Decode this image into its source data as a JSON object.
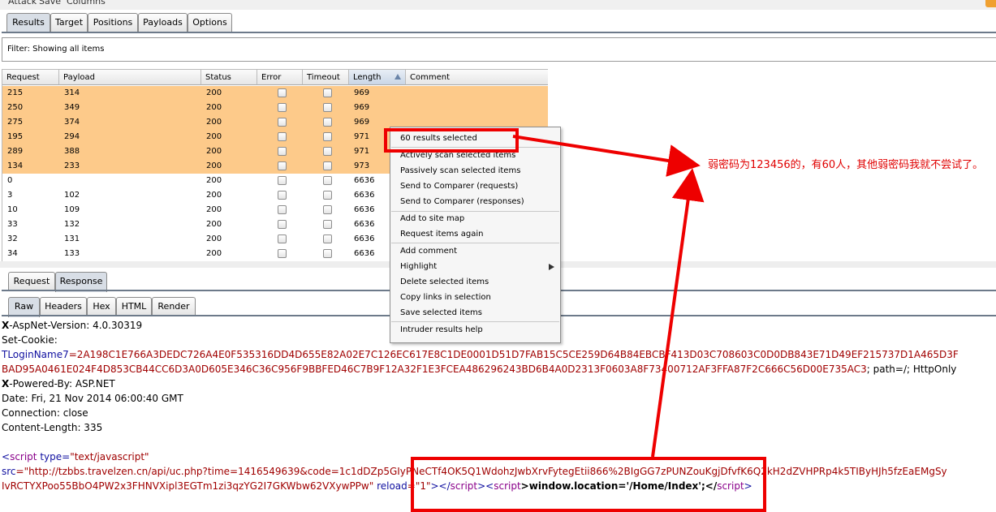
{
  "menubar": {
    "items": [
      "Attack",
      "Save",
      "Columns"
    ]
  },
  "top_tabs": [
    {
      "label": "Results"
    },
    {
      "label": "Target"
    },
    {
      "label": "Positions"
    },
    {
      "label": "Payloads"
    },
    {
      "label": "Options"
    }
  ],
  "filter": {
    "text": "Filter:  Showing all items"
  },
  "table": {
    "columns": [
      "Request",
      "Payload",
      "Status",
      "Error",
      "Timeout",
      "Length",
      "Comment"
    ],
    "sort_column": "Length",
    "rows": [
      {
        "request": "215",
        "payload": "314",
        "status": "200",
        "length": "969",
        "selected": true
      },
      {
        "request": "250",
        "payload": "349",
        "status": "200",
        "length": "969",
        "selected": true
      },
      {
        "request": "275",
        "payload": "374",
        "status": "200",
        "length": "969",
        "selected": true
      },
      {
        "request": "195",
        "payload": "294",
        "status": "200",
        "length": "971",
        "selected": true
      },
      {
        "request": "289",
        "payload": "388",
        "status": "200",
        "length": "971",
        "selected": true
      },
      {
        "request": "134",
        "payload": "233",
        "status": "200",
        "length": "973",
        "selected": true
      },
      {
        "request": "0",
        "payload": "",
        "status": "200",
        "length": "6636",
        "selected": false
      },
      {
        "request": "3",
        "payload": "102",
        "status": "200",
        "length": "6636",
        "selected": false
      },
      {
        "request": "10",
        "payload": "109",
        "status": "200",
        "length": "6636",
        "selected": false
      },
      {
        "request": "33",
        "payload": "132",
        "status": "200",
        "length": "6636",
        "selected": false
      },
      {
        "request": "32",
        "payload": "131",
        "status": "200",
        "length": "6636",
        "selected": false
      },
      {
        "request": "34",
        "payload": "133",
        "status": "200",
        "length": "6636",
        "selected": false
      }
    ]
  },
  "msg_tabs": [
    {
      "label": "Request"
    },
    {
      "label": "Response"
    }
  ],
  "view_tabs": [
    {
      "label": "Raw"
    },
    {
      "label": "Headers"
    },
    {
      "label": "Hex"
    },
    {
      "label": "HTML"
    },
    {
      "label": "Render"
    }
  ],
  "response": {
    "l1_key": "X",
    "l1_rest": "-AspNet-Version: 4.0.30319",
    "l2": "Set-Cookie:",
    "l3_name": "TLoginName7",
    "l3_value": "=2A198C1E766A3DEDC726A4E0F535316DD4D655E82A02E7C126EC617E8C1DE0001D51D7FAB15C5CE259D64B84EBCBF413D03C708603C0D0DB843E71D49EF215737D1A465D3F",
    "l4": "BAD95A0461E024F4D853CB44CC6D3A0D605E346C36C956F9BBFED46C7B9F12A32F1E3FCEA486296243BD6B4A0D2313F0603A8F73400712AF3FFA87F2C666C56D00E735AC3",
    "l4_tail": "; path=/; HttpOnly",
    "l5_key": "X",
    "l5_rest": "-Powered-By: ASP.NET",
    "l6": "Date: Fri, 21 Nov 2014 06:00:40 GMT",
    "l7": "Connection: close",
    "l8": "Content-Length: 335",
    "s1_lt": "<",
    "s1_tag": "script",
    "s1_attr": " type",
    "s1_eq": "=",
    "s1_val": "\"text/javascript\"",
    "s2_attr": "src",
    "s2_val": "=\"http://tzbbs.travelzen.cn/api/uc.php?time=1416549639&code=1c1dDZp5GIyPNeCTf4OK5Q1WdohzJwbXrvFytegEtii866%2BIgGG7zPUNZouKgjDfvfK6Q2kH2dZVHPRp4k5TIByHJh5fzEaEMgSy",
    "s3_val": "IvRCTYXPoo55BbO4PW2x3FHNVXipl3EGTm1zi3qzYG2I7GKWbw62VXywPPw\"",
    "s3_attr": " reload",
    "s3_val2": "=\"1\"",
    "s3_close1": "></",
    "s3_tag1": "script",
    "s3_mid": "><",
    "s3_tag2": "script",
    "s3_code": ">window.location='/Home/Index';</",
    "s3_tag3": "script",
    "s3_end": ">"
  },
  "context_menu": {
    "header": "60 results selected",
    "group1": [
      "Actively scan selected items",
      "Passively scan selected items",
      "Send to Comparer (requests)",
      "Send to Comparer (responses)"
    ],
    "group2": [
      "Add to site map",
      "Request items again"
    ],
    "group3": [
      "Add comment",
      "Highlight",
      "Delete selected items",
      "Copy links in selection",
      "Save selected items"
    ],
    "group4": [
      "Intruder results help"
    ]
  },
  "annotation": {
    "note": "弱密码为123456的，有60人，其他弱密码我就不尝试了。",
    "color": "#ee0000"
  }
}
